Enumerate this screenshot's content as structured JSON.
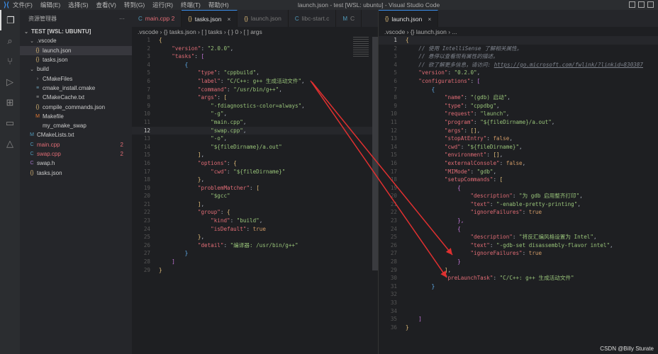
{
  "titlebar": {
    "menu": [
      "文件(F)",
      "编辑(E)",
      "选择(S)",
      "查看(V)",
      "转到(G)",
      "运行(R)",
      "终端(T)",
      "帮助(H)"
    ],
    "title": "launch.json - test [WSL: ubuntu] - Visual Studio Code"
  },
  "sidebar": {
    "title": "资源管理器",
    "more": "···",
    "items": [
      {
        "label": "TEST [WSL: UBUNTU]",
        "icon": "⌄",
        "indent": 0,
        "color": "#ccc",
        "bold": true
      },
      {
        "label": ".vscode",
        "icon": "⌄",
        "indent": 1,
        "color": "#ccc"
      },
      {
        "label": "launch.json",
        "icon": "{}",
        "indent": 2,
        "color": "#ccc",
        "iconColor": "#e5c07b",
        "selected": true
      },
      {
        "label": "tasks.json",
        "icon": "{}",
        "indent": 2,
        "color": "#ccc",
        "iconColor": "#e5c07b"
      },
      {
        "label": "build",
        "icon": "⌄",
        "indent": 1,
        "color": "#ccc"
      },
      {
        "label": "CMakeFiles",
        "icon": "›",
        "indent": 2,
        "color": "#ccc"
      },
      {
        "label": "cmake_install.cmake",
        "icon": "≡",
        "indent": 2,
        "color": "#ccc",
        "iconColor": "#6a9fb5"
      },
      {
        "label": "CMakeCache.txt",
        "icon": "≡",
        "indent": 2,
        "color": "#ccc",
        "iconColor": "#999"
      },
      {
        "label": "compile_commands.json",
        "icon": "{}",
        "indent": 2,
        "color": "#ccc",
        "iconColor": "#e5c07b"
      },
      {
        "label": "Makefile",
        "icon": "M",
        "indent": 2,
        "color": "#ccc",
        "iconColor": "#e37933"
      },
      {
        "label": "my_cmake_swap",
        "icon": "",
        "indent": 2,
        "color": "#ccc"
      },
      {
        "label": "CMakeLists.txt",
        "icon": "M",
        "indent": 1,
        "color": "#ccc",
        "iconColor": "#519aba"
      },
      {
        "label": "main.cpp",
        "icon": "C",
        "indent": 1,
        "color": "#e06c75",
        "iconColor": "#519aba",
        "badge": "2"
      },
      {
        "label": "swap.cpp",
        "icon": "C",
        "indent": 1,
        "color": "#e06c75",
        "iconColor": "#519aba",
        "badge": "2"
      },
      {
        "label": "swap.h",
        "icon": "C",
        "indent": 1,
        "color": "#ccc",
        "iconColor": "#a074c4"
      },
      {
        "label": "tasks.json",
        "icon": "{}",
        "indent": 1,
        "color": "#ccc",
        "iconColor": "#e5c07b"
      }
    ]
  },
  "left_editor": {
    "tabs": [
      {
        "label": "main.cpp 2",
        "icon": "C",
        "color": "#e06c75",
        "iconColor": "#519aba"
      },
      {
        "label": "tasks.json",
        "icon": "{}",
        "color": "#ddd",
        "iconColor": "#e5c07b",
        "active": true,
        "close": "×"
      },
      {
        "label": "launch.json",
        "icon": "{}",
        "color": "#777",
        "iconColor": "#e5c07b"
      },
      {
        "label": "libc-start.c",
        "icon": "C",
        "color": "#777",
        "iconColor": "#519aba"
      },
      {
        "label": "C",
        "icon": "M",
        "color": "#777",
        "iconColor": "#519aba"
      }
    ],
    "breadcrumb": ".vscode › {} tasks.json › [ ] tasks › { } 0 › [ ] args",
    "current_line": 12,
    "lines": [
      [
        [
          "y",
          "{"
        ]
      ],
      [
        [
          "p",
          "    "
        ],
        [
          "k",
          "\"version\""
        ],
        [
          "p",
          ": "
        ],
        [
          "s",
          "\"2.0.0\""
        ],
        [
          "p",
          ","
        ]
      ],
      [
        [
          "p",
          "    "
        ],
        [
          "k",
          "\"tasks\""
        ],
        [
          "p",
          ": "
        ],
        [
          "m",
          "["
        ]
      ],
      [
        [
          "p",
          "        "
        ],
        [
          "bl",
          "{"
        ]
      ],
      [
        [
          "p",
          "            "
        ],
        [
          "k",
          "\"type\""
        ],
        [
          "p",
          ": "
        ],
        [
          "s",
          "\"cppbuild\""
        ],
        [
          "p",
          ","
        ]
      ],
      [
        [
          "p",
          "            "
        ],
        [
          "k",
          "\"label\""
        ],
        [
          "p",
          ": "
        ],
        [
          "s",
          "\"C/C++: g++ 生成活动文件\""
        ],
        [
          "p",
          ","
        ]
      ],
      [
        [
          "p",
          "            "
        ],
        [
          "k",
          "\"command\""
        ],
        [
          "p",
          ": "
        ],
        [
          "s",
          "\"/usr/bin/g++\""
        ],
        [
          "p",
          ","
        ]
      ],
      [
        [
          "p",
          "            "
        ],
        [
          "k",
          "\"args\""
        ],
        [
          "p",
          ": "
        ],
        [
          "y",
          "["
        ]
      ],
      [
        [
          "p",
          "                "
        ],
        [
          "s",
          "\"-fdiagnostics-color=always\""
        ],
        [
          "p",
          ","
        ]
      ],
      [
        [
          "p",
          "                "
        ],
        [
          "s",
          "\"-g\""
        ],
        [
          "p",
          ","
        ]
      ],
      [
        [
          "p",
          "                "
        ],
        [
          "s",
          "\"main.cpp\""
        ],
        [
          "p",
          ","
        ]
      ],
      [
        [
          "p",
          "                "
        ],
        [
          "s",
          "\"swap.cpp\""
        ],
        [
          "p",
          ","
        ]
      ],
      [
        [
          "p",
          "                "
        ],
        [
          "s",
          "\"-o\""
        ],
        [
          "p",
          ","
        ]
      ],
      [
        [
          "p",
          "                "
        ],
        [
          "s",
          "\"${fileDirname}/a.out\""
        ]
      ],
      [
        [
          "p",
          "            "
        ],
        [
          "y",
          "]"
        ],
        [
          "p",
          ","
        ]
      ],
      [
        [
          "p",
          "            "
        ],
        [
          "k",
          "\"options\""
        ],
        [
          "p",
          ": "
        ],
        [
          "y",
          "{"
        ]
      ],
      [
        [
          "p",
          "                "
        ],
        [
          "k",
          "\"cwd\""
        ],
        [
          "p",
          ": "
        ],
        [
          "s",
          "\"${fileDirname}\""
        ]
      ],
      [
        [
          "p",
          "            "
        ],
        [
          "y",
          "}"
        ],
        [
          "p",
          ","
        ]
      ],
      [
        [
          "p",
          "            "
        ],
        [
          "k",
          "\"problemMatcher\""
        ],
        [
          "p",
          ": "
        ],
        [
          "y",
          "["
        ]
      ],
      [
        [
          "p",
          "                "
        ],
        [
          "s",
          "\"$gcc\""
        ]
      ],
      [
        [
          "p",
          "            "
        ],
        [
          "y",
          "]"
        ],
        [
          "p",
          ","
        ]
      ],
      [
        [
          "p",
          "            "
        ],
        [
          "k",
          "\"group\""
        ],
        [
          "p",
          ": "
        ],
        [
          "y",
          "{"
        ]
      ],
      [
        [
          "p",
          "                "
        ],
        [
          "k",
          "\"kind\""
        ],
        [
          "p",
          ": "
        ],
        [
          "s",
          "\"build\""
        ],
        [
          "p",
          ","
        ]
      ],
      [
        [
          "p",
          "                "
        ],
        [
          "k",
          "\"isDefault\""
        ],
        [
          "p",
          ": "
        ],
        [
          "b",
          "true"
        ]
      ],
      [
        [
          "p",
          "            "
        ],
        [
          "y",
          "}"
        ],
        [
          "p",
          ","
        ]
      ],
      [
        [
          "p",
          "            "
        ],
        [
          "k",
          "\"detail\""
        ],
        [
          "p",
          ": "
        ],
        [
          "s",
          "\"编译器: /usr/bin/g++\""
        ]
      ],
      [
        [
          "p",
          "        "
        ],
        [
          "bl",
          "}"
        ]
      ],
      [
        [
          "p",
          "    "
        ],
        [
          "m",
          "]"
        ]
      ],
      [
        [
          "y",
          "}"
        ]
      ]
    ]
  },
  "right_editor": {
    "tabs": [
      {
        "label": "launch.json",
        "icon": "{}",
        "color": "#ddd",
        "iconColor": "#e5c07b",
        "active": true,
        "close": "×"
      }
    ],
    "breadcrumb": ".vscode › {} launch.json › ...",
    "current_line": 1,
    "lines": [
      [
        [
          "y",
          "{"
        ]
      ],
      [
        [
          "p",
          "    "
        ],
        [
          "c",
          "// 使用 IntelliSense 了解相关属性。"
        ]
      ],
      [
        [
          "p",
          "    "
        ],
        [
          "c",
          "// 悬停以查看现有属性的描述。"
        ]
      ],
      [
        [
          "p",
          "    "
        ],
        [
          "c",
          "// 欲了解更多信息，请访问: "
        ],
        [
          "u",
          "https://go.microsoft.com/fwlink/?linkid=830387"
        ]
      ],
      [
        [
          "p",
          "    "
        ],
        [
          "k",
          "\"version\""
        ],
        [
          "p",
          ": "
        ],
        [
          "s",
          "\"0.2.0\""
        ],
        [
          "p",
          ","
        ]
      ],
      [
        [
          "p",
          "    "
        ],
        [
          "k",
          "\"configurations\""
        ],
        [
          "p",
          ": "
        ],
        [
          "m",
          "["
        ]
      ],
      [
        [
          "p",
          "        "
        ],
        [
          "bl",
          "{"
        ]
      ],
      [
        [
          "p",
          "            "
        ],
        [
          "k",
          "\"name\""
        ],
        [
          "p",
          ": "
        ],
        [
          "s",
          "\"(gdb) 启动\""
        ],
        [
          "p",
          ","
        ]
      ],
      [
        [
          "p",
          "            "
        ],
        [
          "k",
          "\"type\""
        ],
        [
          "p",
          ": "
        ],
        [
          "s",
          "\"cppdbg\""
        ],
        [
          "p",
          ","
        ]
      ],
      [
        [
          "p",
          "            "
        ],
        [
          "k",
          "\"request\""
        ],
        [
          "p",
          ": "
        ],
        [
          "s",
          "\"launch\""
        ],
        [
          "p",
          ","
        ]
      ],
      [
        [
          "p",
          "            "
        ],
        [
          "k",
          "\"program\""
        ],
        [
          "p",
          ": "
        ],
        [
          "s",
          "\"${fileDirname}/a.out\""
        ],
        [
          "p",
          ","
        ]
      ],
      [
        [
          "p",
          "            "
        ],
        [
          "k",
          "\"args\""
        ],
        [
          "p",
          ": "
        ],
        [
          "y",
          "[]"
        ],
        [
          "p",
          ","
        ]
      ],
      [
        [
          "p",
          "            "
        ],
        [
          "k",
          "\"stopAtEntry\""
        ],
        [
          "p",
          ": "
        ],
        [
          "b",
          "false"
        ],
        [
          "p",
          ","
        ]
      ],
      [
        [
          "p",
          "            "
        ],
        [
          "k",
          "\"cwd\""
        ],
        [
          "p",
          ": "
        ],
        [
          "s",
          "\"${fileDirname}\""
        ],
        [
          "p",
          ","
        ]
      ],
      [
        [
          "p",
          "            "
        ],
        [
          "k",
          "\"environment\""
        ],
        [
          "p",
          ": "
        ],
        [
          "y",
          "[]"
        ],
        [
          "p",
          ","
        ]
      ],
      [
        [
          "p",
          "            "
        ],
        [
          "k",
          "\"externalConsole\""
        ],
        [
          "p",
          ": "
        ],
        [
          "b",
          "false"
        ],
        [
          "p",
          ","
        ]
      ],
      [
        [
          "p",
          "            "
        ],
        [
          "k",
          "\"MIMode\""
        ],
        [
          "p",
          ": "
        ],
        [
          "s",
          "\"gdb\""
        ],
        [
          "p",
          ","
        ]
      ],
      [
        [
          "p",
          "            "
        ],
        [
          "k",
          "\"setupCommands\""
        ],
        [
          "p",
          ": "
        ],
        [
          "y",
          "["
        ]
      ],
      [
        [
          "p",
          "                "
        ],
        [
          "m",
          "{"
        ]
      ],
      [
        [
          "p",
          "                    "
        ],
        [
          "k",
          "\"description\""
        ],
        [
          "p",
          ": "
        ],
        [
          "s",
          "\"为 gdb 启用整齐打印\""
        ],
        [
          "p",
          ","
        ]
      ],
      [
        [
          "p",
          "                    "
        ],
        [
          "k",
          "\"text\""
        ],
        [
          "p",
          ": "
        ],
        [
          "s",
          "\"-enable-pretty-printing\""
        ],
        [
          "p",
          ","
        ]
      ],
      [
        [
          "p",
          "                    "
        ],
        [
          "k",
          "\"ignoreFailures\""
        ],
        [
          "p",
          ": "
        ],
        [
          "b",
          "true"
        ]
      ],
      [
        [
          "p",
          "                "
        ],
        [
          "m",
          "},"
        ]
      ],
      [
        [
          "p",
          "                "
        ],
        [
          "m",
          "{"
        ]
      ],
      [
        [
          "p",
          "                    "
        ],
        [
          "k",
          "\"description\""
        ],
        [
          "p",
          ": "
        ],
        [
          "s",
          "\"将反汇编风格设置为 Intel\""
        ],
        [
          "p",
          ","
        ]
      ],
      [
        [
          "p",
          "                    "
        ],
        [
          "k",
          "\"text\""
        ],
        [
          "p",
          ": "
        ],
        [
          "s",
          "\"-gdb-set disassembly-flavor intel\""
        ],
        [
          "p",
          ","
        ]
      ],
      [
        [
          "p",
          "                    "
        ],
        [
          "k",
          "\"ignoreFailures\""
        ],
        [
          "p",
          ": "
        ],
        [
          "b",
          "true"
        ]
      ],
      [
        [
          "p",
          "                "
        ],
        [
          "m",
          "}"
        ]
      ],
      [
        [
          "p",
          "            "
        ],
        [
          "y",
          "]"
        ],
        [
          "p",
          ","
        ]
      ],
      [
        [
          "p",
          "            "
        ],
        [
          "k",
          "\"preLaunchTask\""
        ],
        [
          "p",
          ": "
        ],
        [
          "s",
          "\"C/C++: g++ 生成活动文件\""
        ]
      ],
      [
        [
          "p",
          "        "
        ],
        [
          "bl",
          "}"
        ]
      ],
      [],
      [],
      [],
      [
        [
          "p",
          "    "
        ],
        [
          "m",
          "]"
        ]
      ],
      [
        [
          "y",
          "}"
        ]
      ]
    ]
  },
  "watermark": "CSDN @Billy Sturate",
  "colors": {
    "arrow": "#e03030",
    "accent": "#3b8eea"
  }
}
